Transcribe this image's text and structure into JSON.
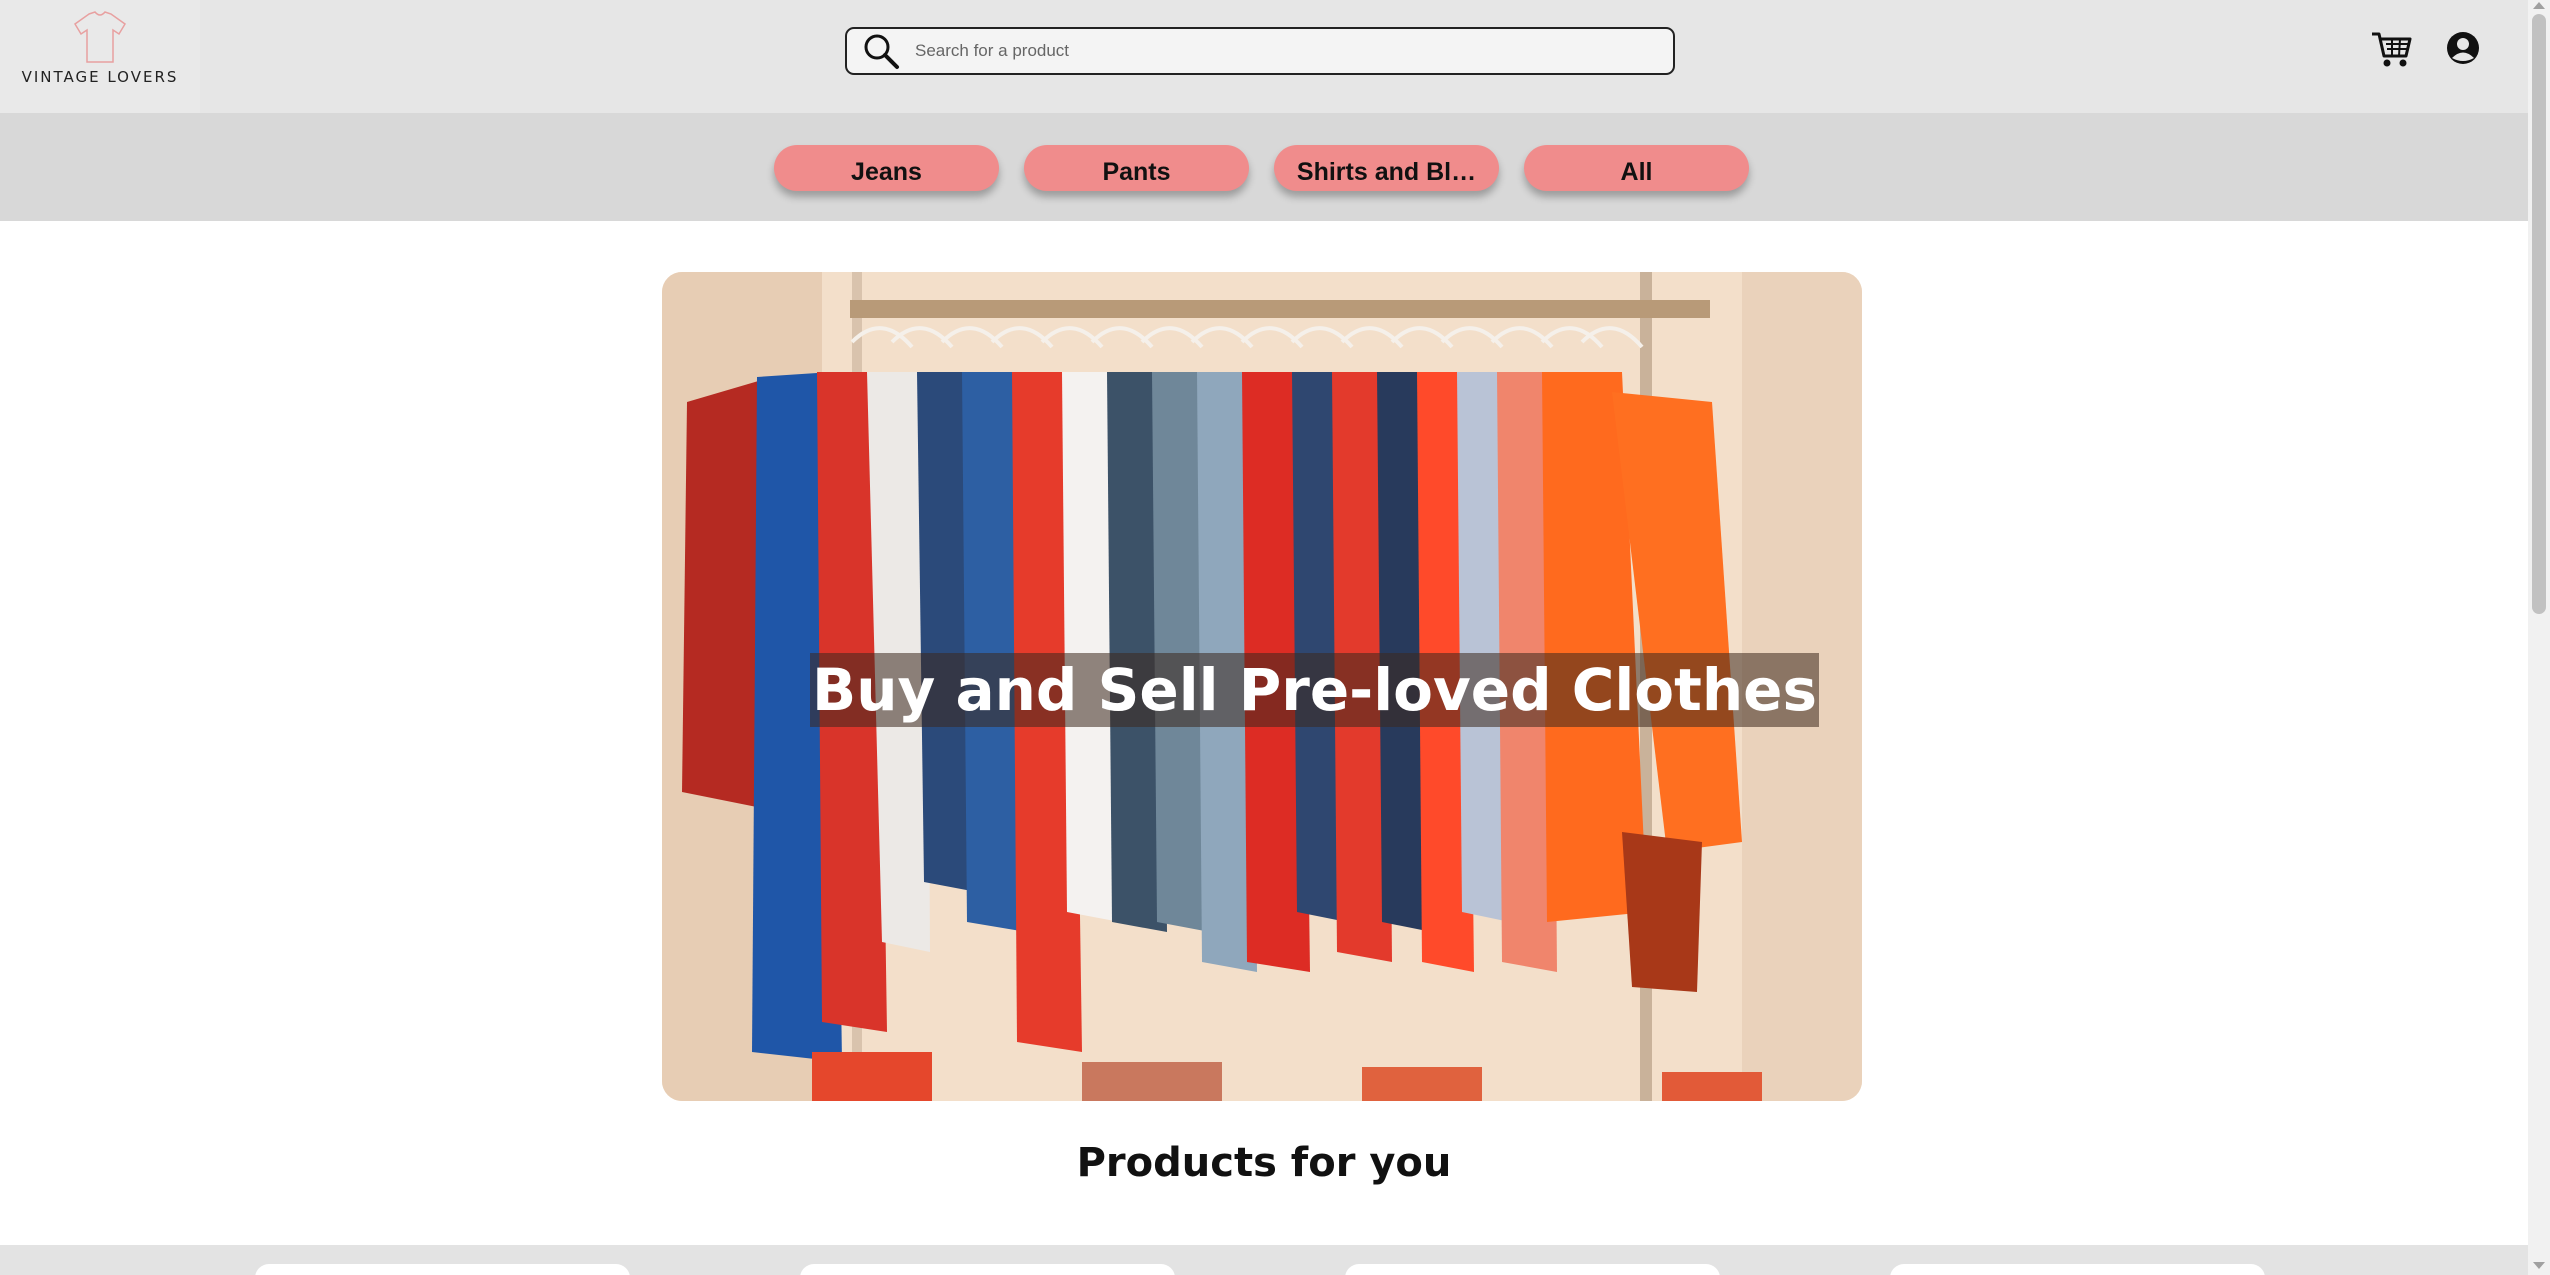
{
  "header": {
    "logo_text": "VINTAGE LOVERS",
    "search": {
      "placeholder": "Search for a product",
      "value": ""
    },
    "cart_icon": "shopping-cart-icon",
    "account_icon": "account-circle-icon"
  },
  "categories": [
    {
      "label": "Jeans"
    },
    {
      "label": "Pants"
    },
    {
      "label": "Shirts and Bl…"
    },
    {
      "label": "All"
    }
  ],
  "hero": {
    "title": "Buy and Sell Pre-loved Clothes"
  },
  "products": {
    "title": "Products for you"
  },
  "colors": {
    "category_button": "#f08c8c",
    "header_bg": "#e6e6e6",
    "category_bar_bg": "#d8d8d8"
  }
}
